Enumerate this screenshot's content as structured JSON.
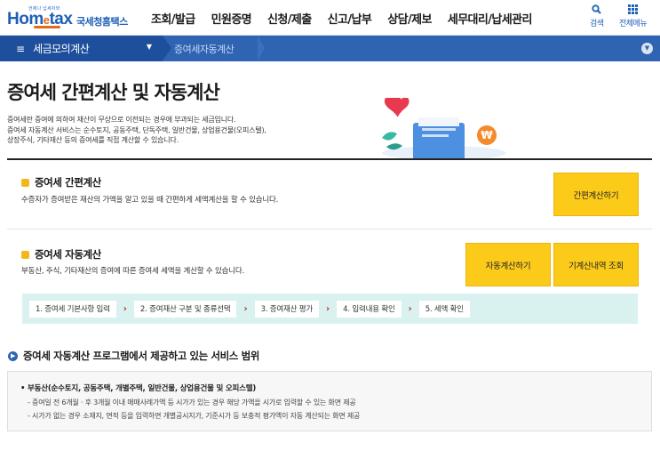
{
  "header": {
    "logo_tagline": "언제나 납세자와",
    "logo_brand_pre": "Hom",
    "logo_brand_e": "e",
    "logo_brand_post": "tax",
    "logo_subtitle": "국세청홈택스",
    "nav": [
      {
        "label": "조회/발급"
      },
      {
        "label": "민원증명"
      },
      {
        "label": "신청/제출"
      },
      {
        "label": "신고/납부"
      },
      {
        "label": "상담/제보"
      },
      {
        "label": "세무대리/납세관리"
      }
    ],
    "search_label": "검색",
    "allmenu_label": "전체메뉴"
  },
  "breadcrumb": {
    "menu_label": "세금모의계산",
    "current": "증여세자동계산"
  },
  "page": {
    "title": "증여세 간편계산 및 자동계산",
    "desc_lines": [
      "증여세란 증여에 의하여 재산이 무상으로 이전되는 경우에 부과되는 세금입니다.",
      "증여세 자동계산 서비스는 순수토지, 공동주택, 단독주택, 일반건물, 상업용건물(오피스텔),",
      "상장주식, 기타재산 등의 증여세를 직접 계산할 수 있습니다."
    ],
    "illus_badge": "₩"
  },
  "simple": {
    "title": "증여세 간편계산",
    "desc": "수증자가 증여받은 재산의 가액을 알고 있을 때 간편하게 세액계산을 할 수 있습니다.",
    "button": "간편계산하기"
  },
  "auto": {
    "title": "증여세 자동계산",
    "desc": "부동산, 주식, 기타재산의 증여에 따른 증여세 세액을 계산할 수 있습니다.",
    "button_auto": "자동계산하기",
    "button_history": "기계산내역 조회"
  },
  "steps": [
    "1. 증여세 기본사항 입력",
    "2. 증여재산 구분 및 종류선택",
    "3. 증여재산 평가",
    "4. 입력내용 확인",
    "5. 세액 확인"
  ],
  "step_arrow": "›",
  "services": {
    "title": "증여세 자동계산 프로그램에서 제공하고 있는 서비스 범위",
    "heading": "• 부동산(순수토지, 공동주택, 개별주택, 일반건물, 상업용건물 및 오피스텔)",
    "items": [
      "- 증여일 전 6개월 · 후 3개월 이내 매매사례가액 등 시가가 있는 경우 해당 가액을 시가로 입력할 수 있는 화면 제공",
      "- 시가가 없는 경우 소재지, 면적 등을 입력하면 개별공시지가, 기준시가 등 보충적 평가액이 자동 계산되는 화면 제공"
    ]
  },
  "colors": {
    "brand_blue": "#1f5fb6",
    "breadcrumb_bar": "#2f64b3",
    "button_yellow": "#fccb1a",
    "steps_bg": "#d9f1ef",
    "step_arrow": "#c62a2a"
  }
}
